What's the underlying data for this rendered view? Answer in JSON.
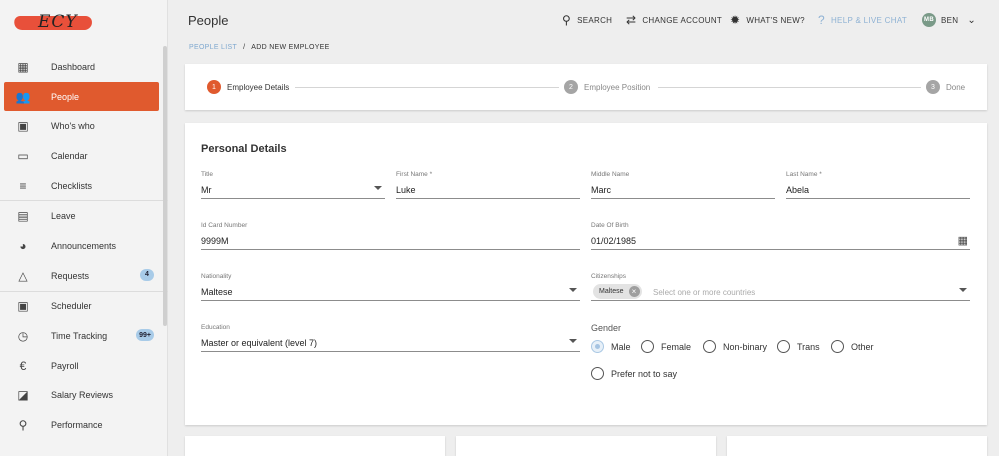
{
  "app": {
    "logo_text": "ECY",
    "page_title": "People"
  },
  "header": {
    "search": "SEARCH",
    "change_account": "CHANGE ACCOUNT",
    "whats_new": "WHAT'S NEW?",
    "help": "HELP & LIVE CHAT",
    "avatar_initials": "MB",
    "user": "BEN"
  },
  "sidebar": {
    "items": [
      {
        "label": "Dashboard",
        "icon": "▦"
      },
      {
        "label": "People",
        "icon": "👥"
      },
      {
        "label": "Who's who",
        "icon": "▣"
      },
      {
        "label": "Calendar",
        "icon": "▭"
      },
      {
        "label": "Checklists",
        "icon": "≡"
      },
      {
        "label": "Leave",
        "icon": "▤"
      },
      {
        "label": "Announcements",
        "icon": "◕"
      },
      {
        "label": "Requests",
        "icon": "△",
        "badge": "4"
      },
      {
        "label": "Scheduler",
        "icon": "▣"
      },
      {
        "label": "Time Tracking",
        "icon": "◷",
        "badge": "99+"
      },
      {
        "label": "Payroll",
        "icon": "€"
      },
      {
        "label": "Salary Reviews",
        "icon": "◪"
      },
      {
        "label": "Performance",
        "icon": "⚲"
      }
    ]
  },
  "breadcrumb": {
    "link": "PEOPLE LIST",
    "sep": "/",
    "current": "ADD NEW EMPLOYEE"
  },
  "stepper": [
    {
      "num": "1",
      "label": "Employee Details"
    },
    {
      "num": "2",
      "label": "Employee Position"
    },
    {
      "num": "3",
      "label": "Done"
    }
  ],
  "form": {
    "title": "Personal Details",
    "title_field": {
      "label": "Title",
      "value": "Mr"
    },
    "first_name": {
      "label": "First Name *",
      "value": "Luke"
    },
    "middle_name": {
      "label": "Middle Name",
      "value": "Marc"
    },
    "last_name": {
      "label": "Last Name *",
      "value": "Abela"
    },
    "id_card": {
      "label": "Id Card Number",
      "value": "9999M"
    },
    "dob": {
      "label": "Date Of Birth",
      "value": "01/02/1985"
    },
    "nationality": {
      "label": "Nationality",
      "value": "Maltese"
    },
    "citizenships": {
      "label": "Citizenships",
      "chip": "Maltese",
      "placeholder": "Select one or more countries"
    },
    "education": {
      "label": "Education",
      "value": "Master or equivalent (level 7)"
    },
    "gender": {
      "label": "Gender",
      "options": [
        "Male",
        "Female",
        "Non-binary",
        "Trans",
        "Other",
        "Prefer not to say"
      ],
      "selected": "Male"
    }
  }
}
